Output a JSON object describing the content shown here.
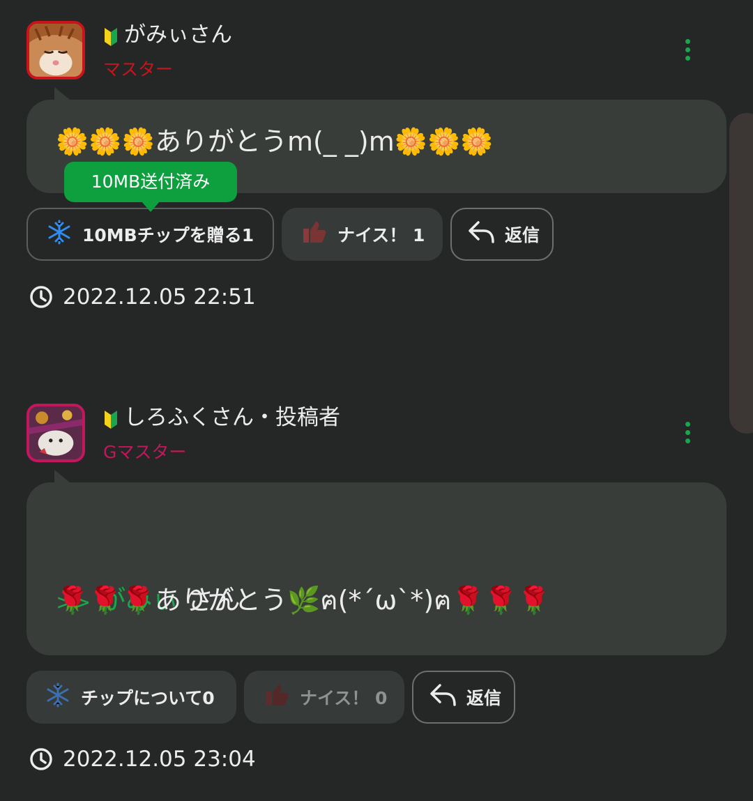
{
  "comments": [
    {
      "username": "がみぃさん",
      "rank": "マスター",
      "message": "🌼🌼🌼ありがとうm(_ _)m🌼🌼🌼",
      "tooltip": "10MB送付済み",
      "tip_button": "10MBチップを贈る1",
      "nice_button": "ナイス！ 1",
      "reply_button": "返信",
      "timestamp": "2022.12.05 22:51"
    },
    {
      "username": "しろふくさん・投稿者",
      "rank": "Gマスター",
      "reply_arrow": ">>",
      "reply_to_name": "がみぃ",
      "reply_to_suffix": " さん",
      "message": "🌹🌹🌹ありがとう🌿ฅ(*´ω`*)ฅ🌹🌹🌹",
      "tip_button": "チップについて0",
      "nice_button": "ナイス！ 0",
      "reply_button": "返信",
      "timestamp": "2022.12.05 23:04"
    }
  ],
  "icons": {
    "beginner": "beginner-mark-icon",
    "more": "kebab-menu-icon",
    "tip": "snowflake-icon",
    "nice": "thumbs-up-icon",
    "reply": "reply-arrow-icon",
    "time": "clock-icon"
  },
  "colors": {
    "accent_green": "#1aa64a",
    "master_red": "#c9141c",
    "gmaster_pink": "#c2185b"
  }
}
